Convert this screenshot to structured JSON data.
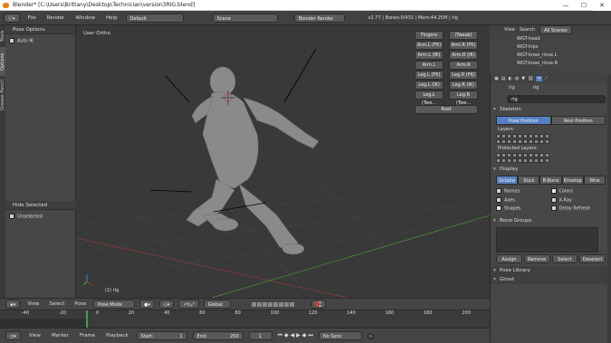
{
  "window": {
    "title": "Blender* [C:\\Users\\Brittany\\Desktop\\Technician\\version3RIG.blend]",
    "controls": [
      "—",
      "☐",
      "✕"
    ]
  },
  "menubar": {
    "items": [
      "File",
      "Render",
      "Window",
      "Help"
    ],
    "layout": "Default",
    "scene": "Scene",
    "engine": "Blender Render",
    "stats": "v2.77 | Bones:0/431 | Mem:44.25M | rig"
  },
  "toolshelf": {
    "tabs": [
      "Tools",
      "Options",
      "Grease Pencil"
    ],
    "pose_options_header": "Pose Options",
    "auto_ik_label": "Auto IK",
    "hide_selected_header": "Hide Selected",
    "unselected_label": "Unselected"
  },
  "viewport": {
    "label": "User Ortho",
    "object_label": "(1) rig",
    "rig_buttons_left": [
      "Fingers",
      "Arm.L (FK)",
      "Arm.L (IK)",
      "Arm.L (Twe...",
      "Leg.L (FK)",
      "Leg.L (IK)",
      "Leg.L (Twe..."
    ],
    "rig_buttons_right": [
      "(Tweak)",
      "Arm.R (FK)",
      "Arm.R (IK)",
      "Arm.R (Twe...",
      "Leg.R (FK)",
      "Leg.R (IK)",
      "Leg.R (Twe..."
    ],
    "root_button": "Root"
  },
  "viewport_header": {
    "view": "View",
    "select": "Select",
    "pose": "Pose",
    "mode": "Pose Mode",
    "orientation": "Global"
  },
  "timeline": {
    "ticks": [
      "-40",
      "-20",
      "0",
      "20",
      "40",
      "60",
      "80",
      "100",
      "120",
      "140",
      "160",
      "180",
      "200",
      "220",
      "240",
      "260"
    ],
    "current_frame_fraction": 0.0
  },
  "timeline_header": {
    "view": "View",
    "marker": "Marker",
    "frame": "Frame",
    "playback": "Playback",
    "start_label": "Start:",
    "start_value": "1",
    "end_label": "End:",
    "end_value": "250",
    "current_value": "1",
    "sync": "No Sync"
  },
  "outliner": {
    "tabs": [
      "View",
      "Search",
      "All Scenes"
    ],
    "items": [
      "WGT-head",
      "WGT-hips",
      "WGT-knee_rinse.L",
      "WGT-knee_rinse.R"
    ]
  },
  "properties": {
    "breadcrumb_a": "rig",
    "breadcrumb_b": "rig",
    "name_field": "rig",
    "skeleton_header": "Skeleton",
    "pose_position": "Pose Position",
    "rest_position": "Rest Position",
    "layers_label": "Layers:",
    "protected_layers_label": "Protected Layers:",
    "display_header": "Display",
    "display_tabs": [
      "Octahe",
      "Stick",
      "B-Bone",
      "Envelop",
      "Wire"
    ],
    "display_checks": [
      {
        "label": "Names",
        "checked": false
      },
      {
        "label": "Colors",
        "checked": true
      },
      {
        "label": "Axes",
        "checked": false
      },
      {
        "label": "X-Ray",
        "checked": false
      },
      {
        "label": "Shapes",
        "checked": true
      },
      {
        "label": "Delay Refresh",
        "checked": false
      }
    ],
    "bone_groups_header": "Bone Groups",
    "assign": "Assign",
    "remove": "Remove",
    "select": "Select",
    "deselect": "Deselect",
    "pose_library_header": "Pose Library",
    "ghost_header": "Ghost"
  }
}
